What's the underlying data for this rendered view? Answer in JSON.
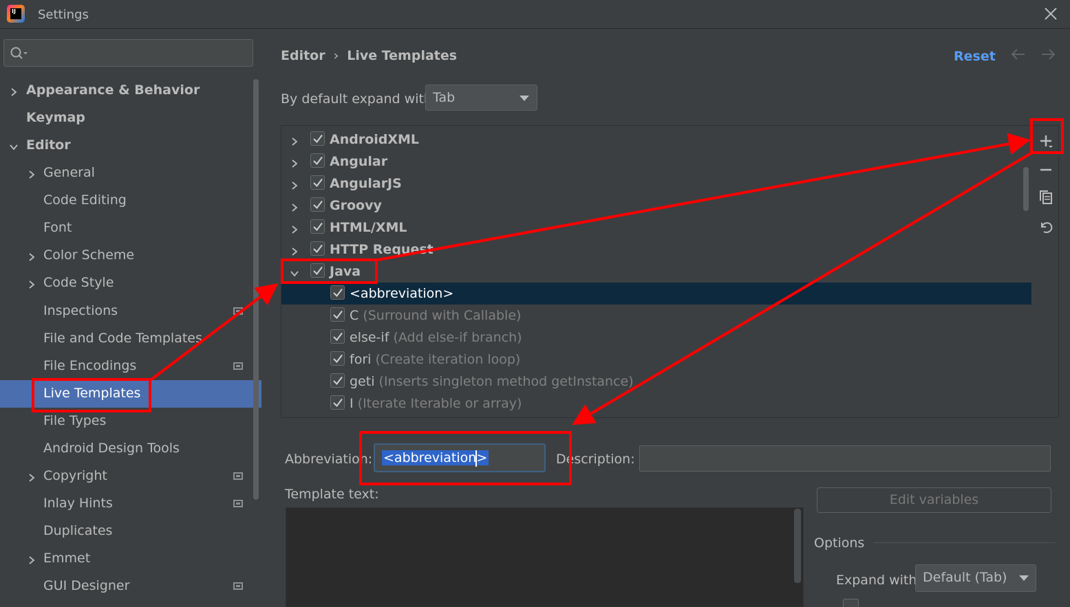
{
  "window": {
    "title": "Settings",
    "app_logo_text": "IJ"
  },
  "sidebar": {
    "search_placeholder": "",
    "items": [
      {
        "label": "Appearance & Behavior",
        "bold": true,
        "chevron": "right"
      },
      {
        "label": "Keymap",
        "bold": true
      },
      {
        "label": "Editor",
        "bold": true,
        "chevron": "down"
      },
      {
        "label": "General",
        "chevron": "right"
      },
      {
        "label": "Code Editing"
      },
      {
        "label": "Font"
      },
      {
        "label": "Color Scheme",
        "chevron": "right"
      },
      {
        "label": "Code Style",
        "chevron": "right"
      },
      {
        "label": "Inspections",
        "project_icon": true
      },
      {
        "label": "File and Code Templates"
      },
      {
        "label": "File Encodings",
        "project_icon": true
      },
      {
        "label": "Live Templates",
        "selected": true
      },
      {
        "label": "File Types"
      },
      {
        "label": "Android Design Tools"
      },
      {
        "label": "Copyright",
        "chevron": "right",
        "project_icon": true
      },
      {
        "label": "Inlay Hints",
        "project_icon": true
      },
      {
        "label": "Duplicates"
      },
      {
        "label": "Emmet",
        "chevron": "right"
      },
      {
        "label": "GUI Designer",
        "project_icon": true
      }
    ]
  },
  "header": {
    "breadcrumb_parent": "Editor",
    "breadcrumb_sep": "›",
    "breadcrumb_current": "Live Templates",
    "reset_label": "Reset"
  },
  "expand": {
    "label": "By default expand with",
    "value": "Tab"
  },
  "template_groups": [
    {
      "name": "AndroidXML",
      "checked": true,
      "expanded": false
    },
    {
      "name": "Angular",
      "checked": true,
      "expanded": false
    },
    {
      "name": "AngularJS",
      "checked": true,
      "expanded": false
    },
    {
      "name": "Groovy",
      "checked": true,
      "expanded": false
    },
    {
      "name": "HTML/XML",
      "checked": true,
      "expanded": false
    },
    {
      "name": "HTTP Request",
      "checked": true,
      "expanded": false
    },
    {
      "name": "Java",
      "checked": true,
      "expanded": true
    }
  ],
  "java_templates": [
    {
      "abbr": "<abbreviation>",
      "desc": "",
      "selected": true
    },
    {
      "abbr": "C",
      "desc": "(Surround with Callable)"
    },
    {
      "abbr": "else-if",
      "desc": "(Add else-if branch)"
    },
    {
      "abbr": "fori",
      "desc": "(Create iteration loop)"
    },
    {
      "abbr": "geti",
      "desc": "(Inserts singleton method getInstance)"
    },
    {
      "abbr": "I",
      "desc": "(Iterate Iterable or array)"
    }
  ],
  "toolbar_icons": [
    "add-icon",
    "remove-icon",
    "copy-icon",
    "restore-icon"
  ],
  "form": {
    "abbreviation_label": "Abbreviation:",
    "abbreviation_value": "<abbreviation>",
    "description_label": "Description:",
    "description_value": "",
    "template_text_label": "Template text:",
    "template_text_value": "",
    "edit_variables_label": "Edit variables",
    "options_label": "Options",
    "expand_with_label": "Expand with",
    "expand_with_value": "Default (Tab)"
  },
  "colors": {
    "background": "#3c3f41",
    "selection": "#4b6eaf",
    "tree_selection": "#0d293e",
    "link": "#589df6",
    "annotation": "#ff0000"
  }
}
